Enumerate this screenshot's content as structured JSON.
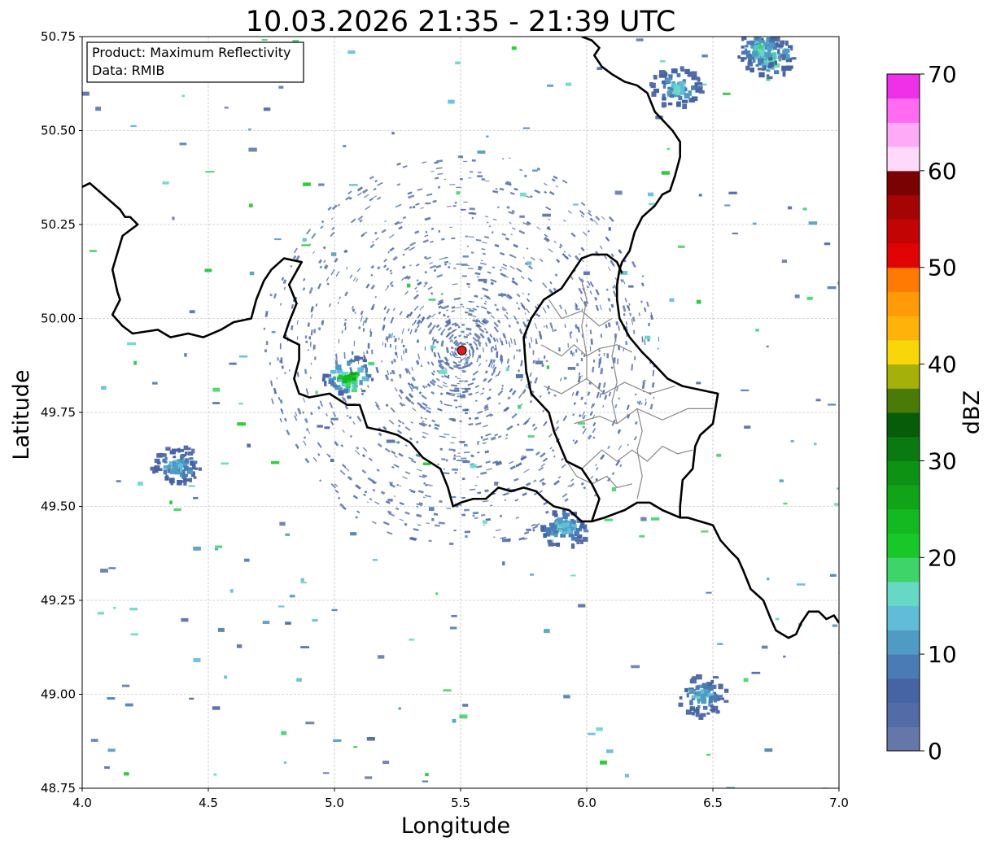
{
  "chart_data": {
    "type": "heatmap",
    "title": "10.03.2026 21:35 - 21:39 UTC",
    "xlabel": "Longitude",
    "ylabel": "Latitude",
    "xlim": [
      4.0,
      7.0
    ],
    "ylim": [
      48.75,
      50.75
    ],
    "xticks": [
      4.0,
      4.5,
      5.0,
      5.5,
      6.0,
      6.5,
      7.0
    ],
    "xtick_labels": [
      "4.0",
      "4.5",
      "5.0",
      "5.5",
      "6.0",
      "6.5",
      "7.0"
    ],
    "yticks": [
      48.75,
      49.0,
      49.25,
      49.5,
      49.75,
      50.0,
      50.25,
      50.5,
      50.75
    ],
    "ytick_labels": [
      "48.75",
      "49.00",
      "49.25",
      "49.50",
      "49.75",
      "50.00",
      "50.25",
      "50.50",
      "50.75"
    ],
    "grid": true,
    "info_box": {
      "product": "Product: Maximum Reflectivity",
      "data": "Data: RMIB"
    },
    "radar_site": {
      "lon": 5.505,
      "lat": 49.915,
      "color": "#e31a1c"
    },
    "colorbar": {
      "label": "dBZ",
      "min": 0,
      "max": 70,
      "ticks": [
        0,
        10,
        20,
        30,
        40,
        50,
        60,
        70
      ],
      "tick_labels": [
        "0",
        "10",
        "20",
        "30",
        "40",
        "50",
        "60",
        "70"
      ],
      "colors": [
        "#6477a8",
        "#536ba6",
        "#4663a4",
        "#4a7bb5",
        "#509bc4",
        "#60bcd8",
        "#66d8c4",
        "#3dd46a",
        "#18c828",
        "#14b820",
        "#10a418",
        "#0e9214",
        "#0a7a10",
        "#075c0a",
        "#4a7a08",
        "#a6b00a",
        "#f8d60a",
        "#ffb20a",
        "#ff9a08",
        "#ff7a02",
        "#e00404",
        "#c20404",
        "#a40404",
        "#7a0202",
        "#ffd8fa",
        "#ffaaf6",
        "#ff6cf2",
        "#ee30e8"
      ]
    },
    "echo_cells": [
      {
        "name": "cell near 5.05E 49.85N",
        "lon": 5.05,
        "lat": 49.85,
        "max_dbz": 30
      },
      {
        "name": "cell near 4.37E 49.61N",
        "lon": 4.37,
        "lat": 49.61,
        "max_dbz": 18
      },
      {
        "name": "cell near 6.72E 50.70N",
        "lon": 6.72,
        "lat": 50.7,
        "max_dbz": 25
      },
      {
        "name": "cell near 5.90E 49.45N",
        "lon": 5.9,
        "lat": 49.45,
        "max_dbz": 20
      },
      {
        "name": "cell near 6.35E 50.62N",
        "lon": 6.35,
        "lat": 50.62,
        "max_dbz": 20
      },
      {
        "name": "cell near 6.45E 49.00N",
        "lon": 6.45,
        "lat": 49.0,
        "max_dbz": 18
      },
      {
        "name": "cell near 6.68E 50.72N",
        "lon": 6.68,
        "lat": 50.72,
        "max_dbz": 22
      }
    ],
    "borders": {
      "france": [
        [
          4.0,
          50.35
        ],
        [
          4.03,
          50.36
        ],
        [
          4.15,
          50.29
        ],
        [
          4.17,
          50.27
        ],
        [
          4.19,
          50.27
        ],
        [
          4.22,
          50.25
        ],
        [
          4.16,
          50.22
        ],
        [
          4.12,
          50.13
        ],
        [
          4.14,
          50.07
        ],
        [
          4.15,
          50.05
        ],
        [
          4.12,
          50.01
        ],
        [
          4.16,
          49.98
        ],
        [
          4.2,
          49.96
        ],
        [
          4.3,
          49.97
        ],
        [
          4.35,
          49.95
        ],
        [
          4.42,
          49.96
        ],
        [
          4.48,
          49.95
        ],
        [
          4.55,
          49.97
        ],
        [
          4.6,
          49.99
        ],
        [
          4.67,
          50.0
        ],
        [
          4.69,
          50.05
        ],
        [
          4.72,
          50.1
        ],
        [
          4.75,
          50.13
        ],
        [
          4.8,
          50.16
        ],
        [
          4.87,
          50.15
        ],
        [
          4.82,
          50.09
        ],
        [
          4.85,
          50.04
        ],
        [
          4.82,
          49.99
        ],
        [
          4.8,
          49.95
        ],
        [
          4.86,
          49.93
        ],
        [
          4.86,
          49.89
        ],
        [
          4.84,
          49.84
        ],
        [
          4.86,
          49.8
        ],
        [
          4.9,
          49.79
        ],
        [
          4.98,
          49.8
        ],
        [
          5.05,
          49.77
        ],
        [
          5.1,
          49.77
        ],
        [
          5.13,
          49.71
        ],
        [
          5.2,
          49.7
        ],
        [
          5.25,
          49.69
        ],
        [
          5.3,
          49.67
        ],
        [
          5.35,
          49.63
        ],
        [
          5.42,
          49.6
        ],
        [
          5.45,
          49.55
        ],
        [
          5.47,
          49.5
        ],
        [
          5.5,
          49.51
        ],
        [
          5.55,
          49.52
        ],
        [
          5.6,
          49.52
        ],
        [
          5.65,
          49.55
        ],
        [
          5.7,
          49.54
        ],
        [
          5.75,
          49.55
        ],
        [
          5.8,
          49.54
        ],
        [
          5.83,
          49.52
        ],
        [
          5.87,
          49.5
        ],
        [
          5.93,
          49.49
        ],
        [
          5.98,
          49.46
        ],
        [
          6.02,
          49.46
        ],
        [
          6.07,
          49.47
        ],
        [
          6.15,
          49.49
        ],
        [
          6.2,
          49.51
        ],
        [
          6.25,
          49.51
        ],
        [
          6.3,
          49.49
        ],
        [
          6.37,
          49.47
        ],
        [
          6.4,
          49.47
        ],
        [
          6.45,
          49.46
        ],
        [
          6.5,
          49.45
        ],
        [
          6.53,
          49.41
        ],
        [
          6.57,
          49.38
        ],
        [
          6.6,
          49.36
        ],
        [
          6.62,
          49.33
        ],
        [
          6.65,
          49.28
        ],
        [
          6.7,
          49.25
        ],
        [
          6.73,
          49.2
        ],
        [
          6.75,
          49.17
        ],
        [
          6.8,
          49.15
        ],
        [
          6.83,
          49.16
        ],
        [
          6.85,
          49.19
        ],
        [
          6.88,
          49.22
        ],
        [
          6.92,
          49.22
        ],
        [
          6.95,
          49.2
        ],
        [
          6.98,
          49.21
        ],
        [
          7.0,
          49.19
        ]
      ],
      "germany": [
        [
          5.98,
          50.75
        ],
        [
          6.02,
          50.74
        ],
        [
          6.05,
          50.72
        ],
        [
          6.03,
          50.7
        ],
        [
          6.06,
          50.67
        ],
        [
          6.1,
          50.65
        ],
        [
          6.15,
          50.63
        ],
        [
          6.2,
          50.62
        ],
        [
          6.24,
          50.6
        ],
        [
          6.27,
          50.55
        ],
        [
          6.34,
          50.5
        ],
        [
          6.37,
          50.47
        ],
        [
          6.37,
          50.43
        ],
        [
          6.35,
          50.38
        ],
        [
          6.33,
          50.34
        ],
        [
          6.3,
          50.33
        ],
        [
          6.27,
          50.3
        ],
        [
          6.22,
          50.27
        ],
        [
          6.19,
          50.23
        ],
        [
          6.17,
          50.18
        ],
        [
          6.14,
          50.15
        ],
        [
          6.13,
          50.13
        ],
        [
          6.12,
          50.09
        ],
        [
          6.12,
          50.05
        ],
        [
          6.13,
          50.0
        ],
        [
          6.17,
          49.95
        ],
        [
          6.22,
          49.91
        ],
        [
          6.25,
          49.89
        ],
        [
          6.32,
          49.84
        ],
        [
          6.38,
          49.82
        ],
        [
          6.45,
          49.81
        ],
        [
          6.52,
          49.8
        ],
        [
          6.51,
          49.76
        ],
        [
          6.5,
          49.72
        ],
        [
          6.45,
          49.69
        ],
        [
          6.43,
          49.66
        ],
        [
          6.42,
          49.6
        ],
        [
          6.38,
          49.57
        ],
        [
          6.37,
          49.5
        ],
        [
          6.37,
          49.47
        ]
      ],
      "luxembourg": [
        [
          6.02,
          49.46
        ],
        [
          6.05,
          49.52
        ],
        [
          6.02,
          49.56
        ],
        [
          5.98,
          49.6
        ],
        [
          5.92,
          49.62
        ],
        [
          5.87,
          49.7
        ],
        [
          5.85,
          49.75
        ],
        [
          5.78,
          49.8
        ],
        [
          5.76,
          49.86
        ],
        [
          5.75,
          49.95
        ],
        [
          5.78,
          50.0
        ],
        [
          5.83,
          50.05
        ],
        [
          5.9,
          50.08
        ],
        [
          5.95,
          50.13
        ],
        [
          5.98,
          50.16
        ],
        [
          6.02,
          50.17
        ],
        [
          6.08,
          50.17
        ],
        [
          6.12,
          50.15
        ],
        [
          6.14,
          50.12
        ]
      ]
    },
    "admin_lines": [
      [
        [
          5.98,
          49.6
        ],
        [
          6.06,
          49.65
        ],
        [
          6.12,
          49.62
        ],
        [
          6.18,
          49.65
        ],
        [
          6.24,
          49.62
        ],
        [
          6.3,
          49.66
        ],
        [
          6.36,
          49.64
        ],
        [
          6.42,
          49.65
        ]
      ],
      [
        [
          5.95,
          49.72
        ],
        [
          6.05,
          49.74
        ],
        [
          6.12,
          49.72
        ],
        [
          6.2,
          49.76
        ],
        [
          6.3,
          49.73
        ],
        [
          6.4,
          49.76
        ],
        [
          6.5,
          49.76
        ]
      ],
      [
        [
          5.83,
          49.82
        ],
        [
          5.9,
          49.8
        ],
        [
          6.0,
          49.84
        ],
        [
          6.07,
          49.8
        ],
        [
          6.15,
          49.83
        ],
        [
          6.25,
          49.8
        ],
        [
          6.35,
          49.82
        ]
      ],
      [
        [
          5.82,
          49.93
        ],
        [
          5.9,
          49.9
        ],
        [
          5.95,
          49.93
        ],
        [
          6.0,
          49.9
        ],
        [
          6.05,
          49.92
        ],
        [
          6.12,
          49.93
        ],
        [
          6.18,
          49.91
        ]
      ],
      [
        [
          5.85,
          50.05
        ],
        [
          5.9,
          50.0
        ],
        [
          5.98,
          50.02
        ],
        [
          6.05,
          49.98
        ],
        [
          6.1,
          50.0
        ]
      ],
      [
        [
          6.0,
          49.84
        ],
        [
          6.0,
          49.9
        ],
        [
          5.98,
          49.98
        ],
        [
          6.0,
          50.05
        ],
        [
          5.98,
          50.1
        ]
      ],
      [
        [
          6.12,
          49.72
        ],
        [
          6.1,
          49.78
        ],
        [
          6.12,
          49.83
        ],
        [
          6.1,
          49.9
        ],
        [
          6.12,
          49.96
        ]
      ],
      [
        [
          6.2,
          49.76
        ],
        [
          6.22,
          49.7
        ],
        [
          6.2,
          49.65
        ],
        [
          6.22,
          49.58
        ],
        [
          6.2,
          49.52
        ]
      ],
      [
        [
          5.92,
          49.62
        ],
        [
          5.96,
          49.58
        ],
        [
          6.02,
          49.56
        ],
        [
          6.08,
          49.58
        ],
        [
          6.12,
          49.55
        ],
        [
          6.18,
          49.56
        ]
      ]
    ]
  }
}
